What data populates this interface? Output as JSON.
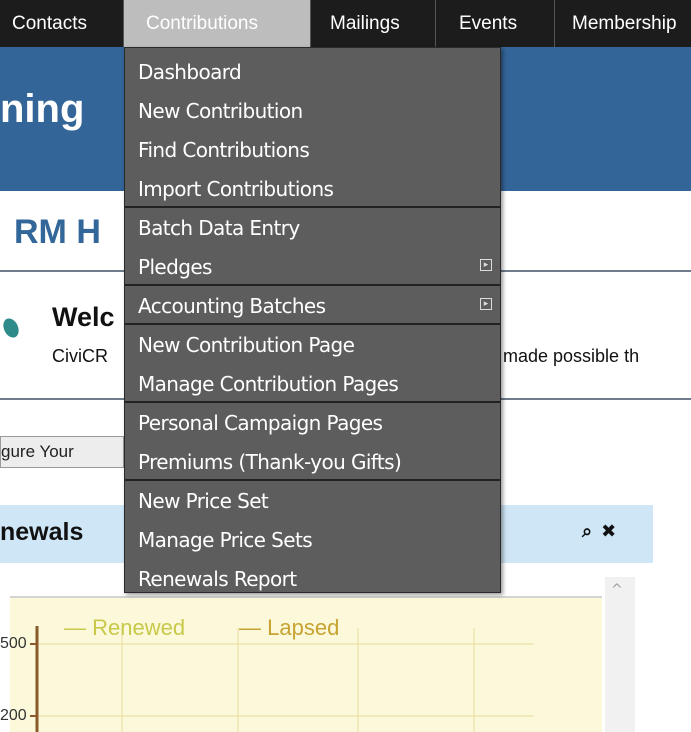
{
  "nav": {
    "items": [
      {
        "label": "Contacts",
        "left": 0,
        "width": 124
      },
      {
        "label": "Contributions",
        "left": 124,
        "width": 186,
        "active": true
      },
      {
        "label": "Mailings",
        "left": 310,
        "width": 125
      },
      {
        "label": "Events",
        "left": 435,
        "width": 119
      },
      {
        "label": "Membership",
        "left": 554,
        "width": 137
      }
    ]
  },
  "header": {
    "title": "ning"
  },
  "page": {
    "heading": "RM H",
    "welcome": "Welc",
    "welcome_text": "CiviCR",
    "welcome_text_right": "made possible th",
    "configure_button": "gure Your"
  },
  "dashlet": {
    "title": "newals",
    "icon_zoom": "⌕",
    "icon_close": "✖",
    "scroll_up": "^"
  },
  "chart_data": {
    "type": "line",
    "series": [
      {
        "name": "Renewed",
        "values": []
      },
      {
        "name": "Lapsed",
        "values": []
      }
    ],
    "y_ticks": [
      "500",
      "200"
    ],
    "legend_placement": "top",
    "grid": true
  },
  "menu": {
    "groups": [
      [
        {
          "label": "Dashboard"
        },
        {
          "label": "New Contribution"
        },
        {
          "label": "Find Contributions"
        },
        {
          "label": "Import Contributions"
        }
      ],
      [
        {
          "label": "Batch Data Entry"
        },
        {
          "label": "Pledges",
          "submenu": true
        }
      ],
      [
        {
          "label": "Accounting Batches",
          "submenu": true
        }
      ],
      [
        {
          "label": "New Contribution Page"
        },
        {
          "label": "Manage Contribution Pages"
        }
      ],
      [
        {
          "label": "Personal Campaign Pages"
        },
        {
          "label": "Premiums (Thank-you Gifts)"
        }
      ],
      [
        {
          "label": "New Price Set"
        },
        {
          "label": "Manage Price Sets"
        },
        {
          "label": "Renewals Report"
        }
      ]
    ],
    "submenu_icon": "▸"
  }
}
